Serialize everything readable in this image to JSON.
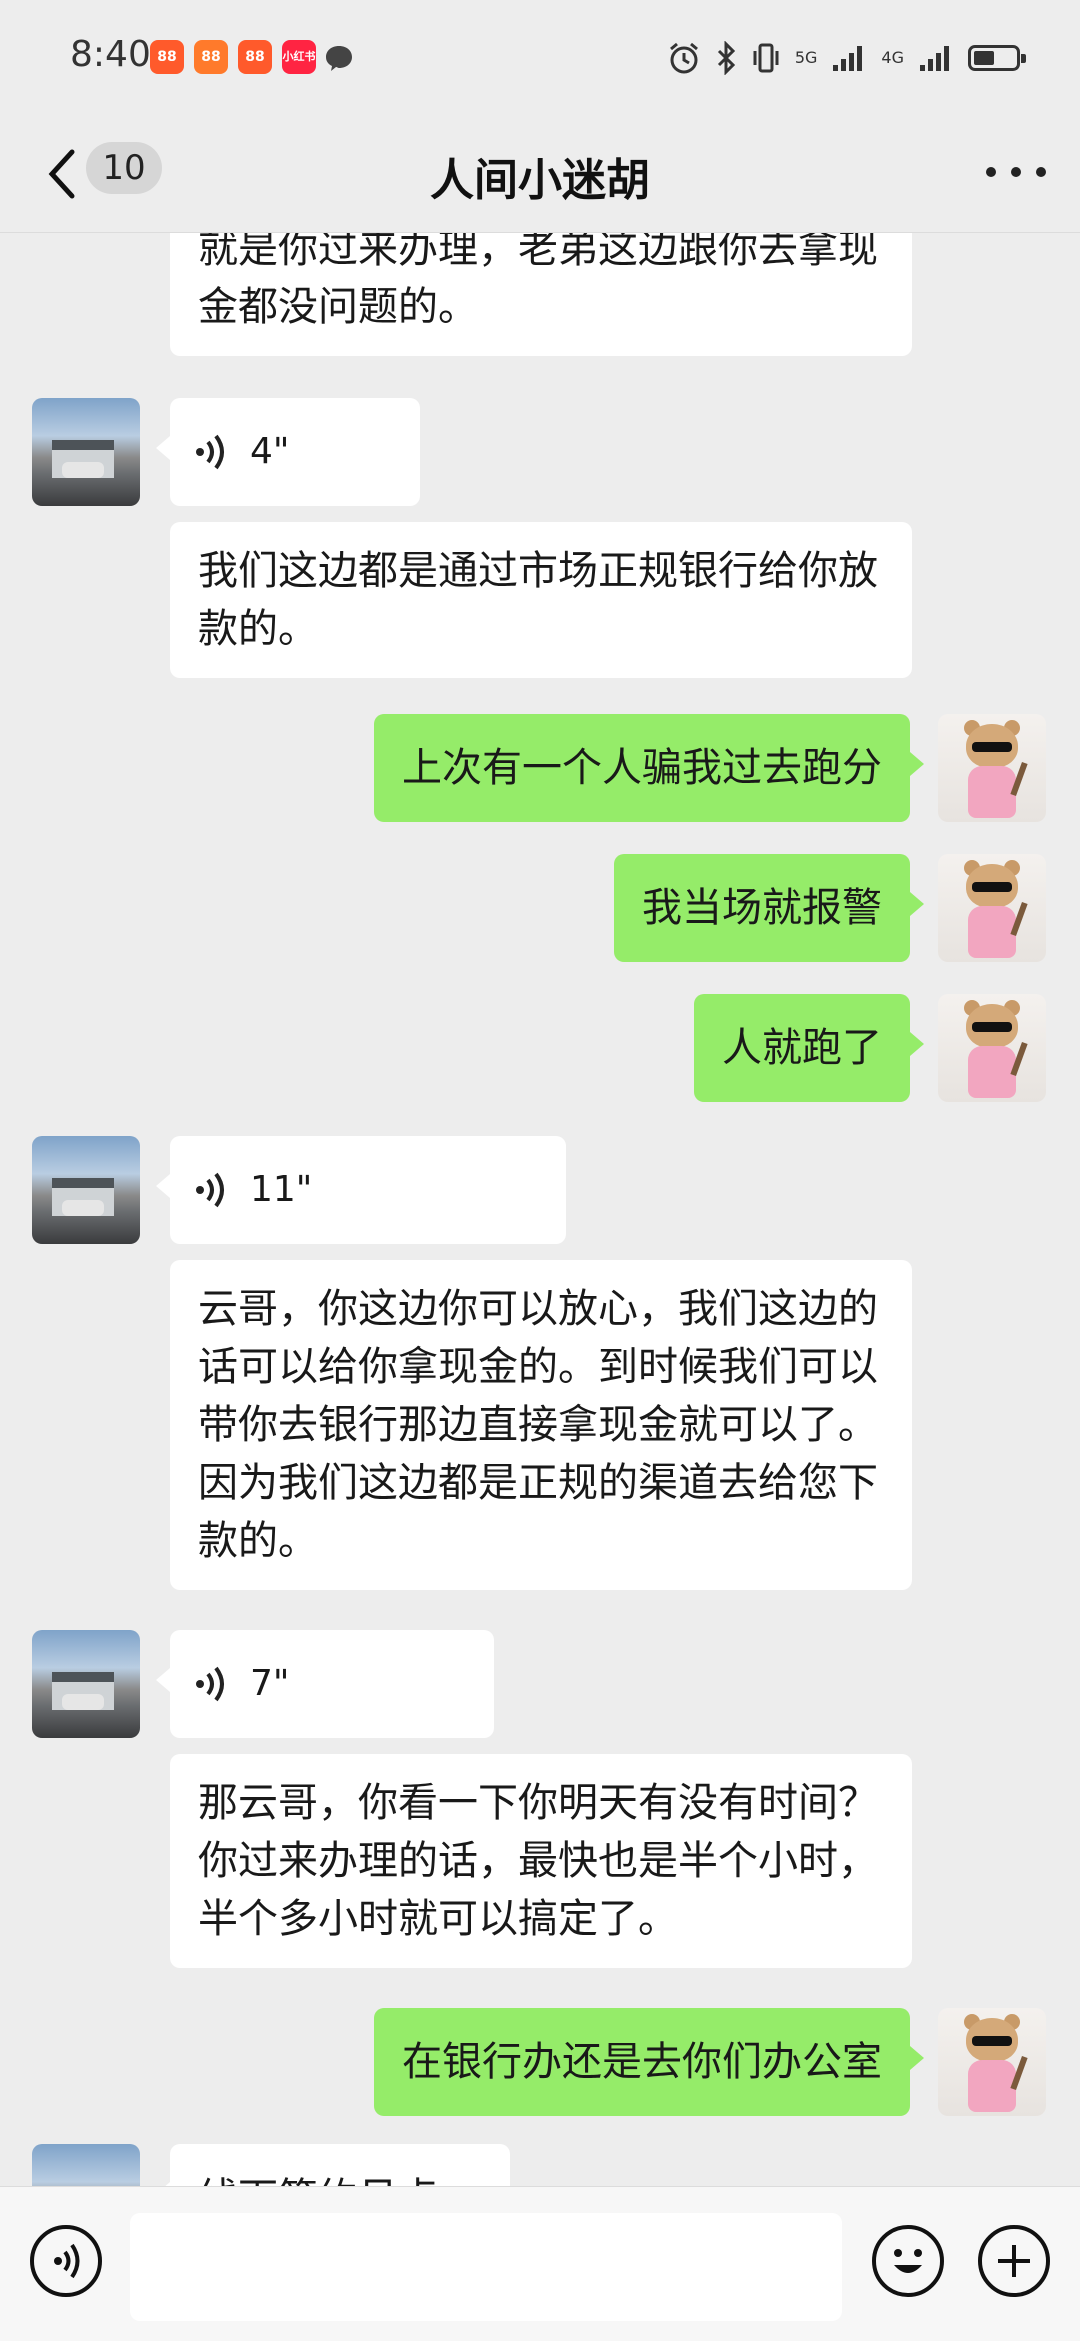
{
  "status_bar": {
    "time": "8:40",
    "app_icons": [
      {
        "label": "88",
        "color": "#ff5a2b"
      },
      {
        "label": "88",
        "color": "#ff7a2b"
      },
      {
        "label": "88",
        "color": "#ff5a2b"
      },
      {
        "label": "小红书",
        "color": "#ff2442"
      }
    ],
    "network1": "5G",
    "network2": "4G"
  },
  "header": {
    "unread_count": "10",
    "title": "人间小迷胡",
    "back_icon": "chevron-left-icon",
    "more_icon": "more-dots-icon"
  },
  "messages": [
    {
      "from": "peer",
      "type": "text",
      "text": "就是你过来办理，老弟这边跟你去拿现金都没问题的。"
    },
    {
      "from": "peer",
      "type": "voice",
      "duration": "4\""
    },
    {
      "from": "peer",
      "type": "text",
      "text": "我们这边都是通过市场正规银行给你放款的。"
    },
    {
      "from": "me",
      "type": "text",
      "text": "上次有一个人骗我过去跑分"
    },
    {
      "from": "me",
      "type": "text",
      "text": "我当场就报警"
    },
    {
      "from": "me",
      "type": "text",
      "text": "人就跑了"
    },
    {
      "from": "peer",
      "type": "voice",
      "duration": "11\""
    },
    {
      "from": "peer",
      "type": "text",
      "text": "云哥，你这边你可以放心，我们这边的话可以给你拿现金的。到时候我们可以带你去银行那边直接拿现金就可以了。因为我们这边都是正规的渠道去给您下款的。"
    },
    {
      "from": "peer",
      "type": "voice",
      "duration": "7\""
    },
    {
      "from": "peer",
      "type": "text",
      "text": "那云哥，你看一下你明天有没有时间？你过来办理的话，最快也是半个小时，半个多小时就可以搞定了。"
    },
    {
      "from": "me",
      "type": "text",
      "text": "在银行办还是去你们办公室"
    },
    {
      "from": "peer",
      "type": "text",
      "text": "线下签约见点"
    }
  ],
  "input_bar": {
    "voice_icon": "voice-mode-icon",
    "emoji_icon": "emoji-icon",
    "plus_icon": "plus-icon"
  },
  "colors": {
    "background": "#ededed",
    "out_bubble": "#95ec69",
    "in_bubble": "#ffffff"
  }
}
